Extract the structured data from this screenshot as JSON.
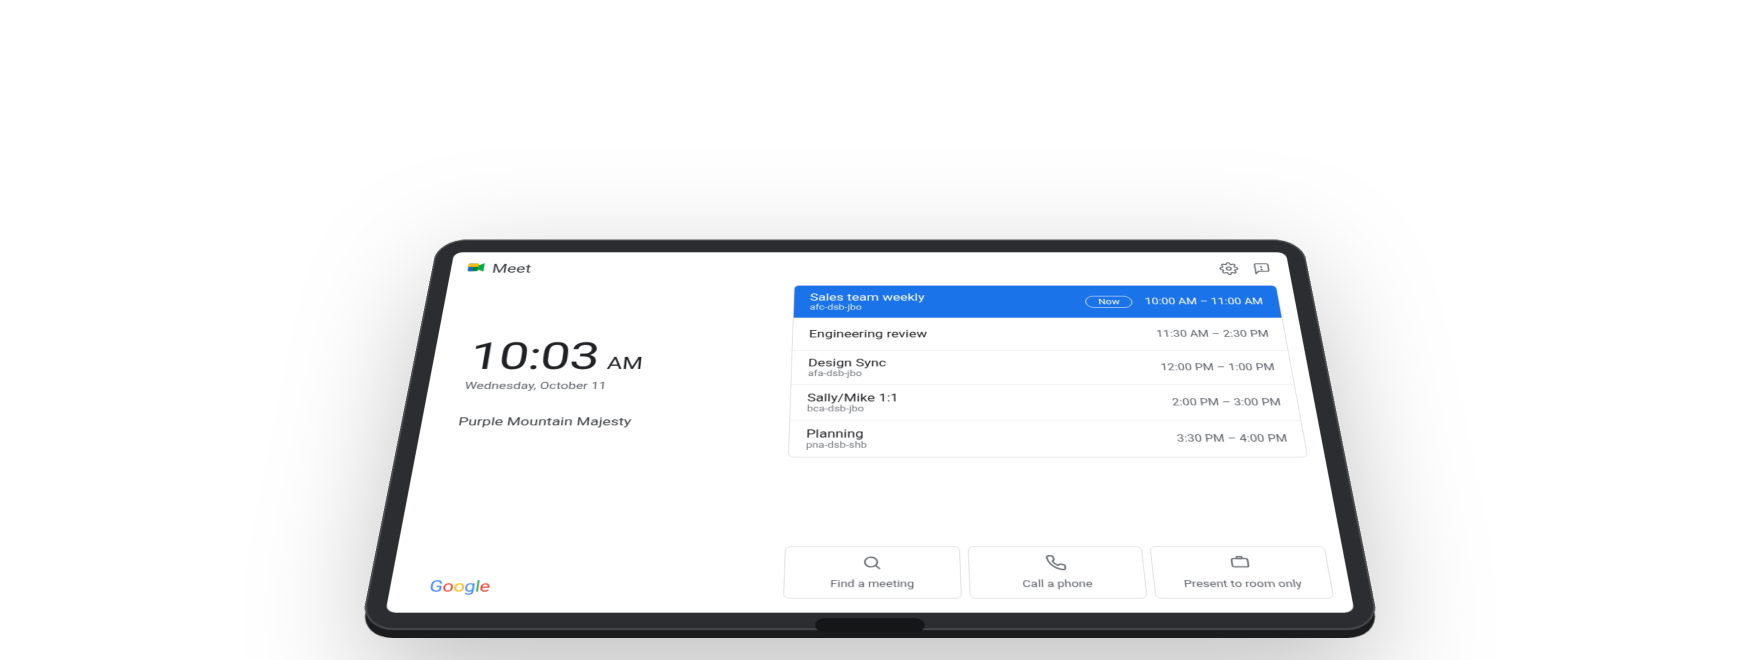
{
  "header": {
    "app_name": "Meet"
  },
  "clock": {
    "time": "10:03",
    "ampm": "AM",
    "date": "Wednesday, October 11"
  },
  "room": {
    "name": "Purple Mountain Majesty"
  },
  "meetings": [
    {
      "title": "Sales team weekly",
      "code": "afc-dsb-jbo",
      "time": "10:00 AM – 11:00 AM",
      "badge": "Now",
      "selected": true
    },
    {
      "title": "Engineering review",
      "code": "",
      "time": "11:30 AM – 2:30 PM"
    },
    {
      "title": "Design Sync",
      "code": "afa-dsb-jbo",
      "time": "12:00 PM – 1:00 PM"
    },
    {
      "title": "Sally/Mike 1:1",
      "code": "bca-dsb-jbo",
      "time": "2:00 PM – 3:00 PM"
    },
    {
      "title": "Planning",
      "code": "pna-dsb-shb",
      "time": "3:30 PM – 4:00 PM"
    }
  ],
  "actions": {
    "find": {
      "label": "Find a meeting"
    },
    "call": {
      "label": "Call a phone"
    },
    "present": {
      "label": "Present to room only"
    }
  },
  "footer": {
    "brand": "Google"
  }
}
